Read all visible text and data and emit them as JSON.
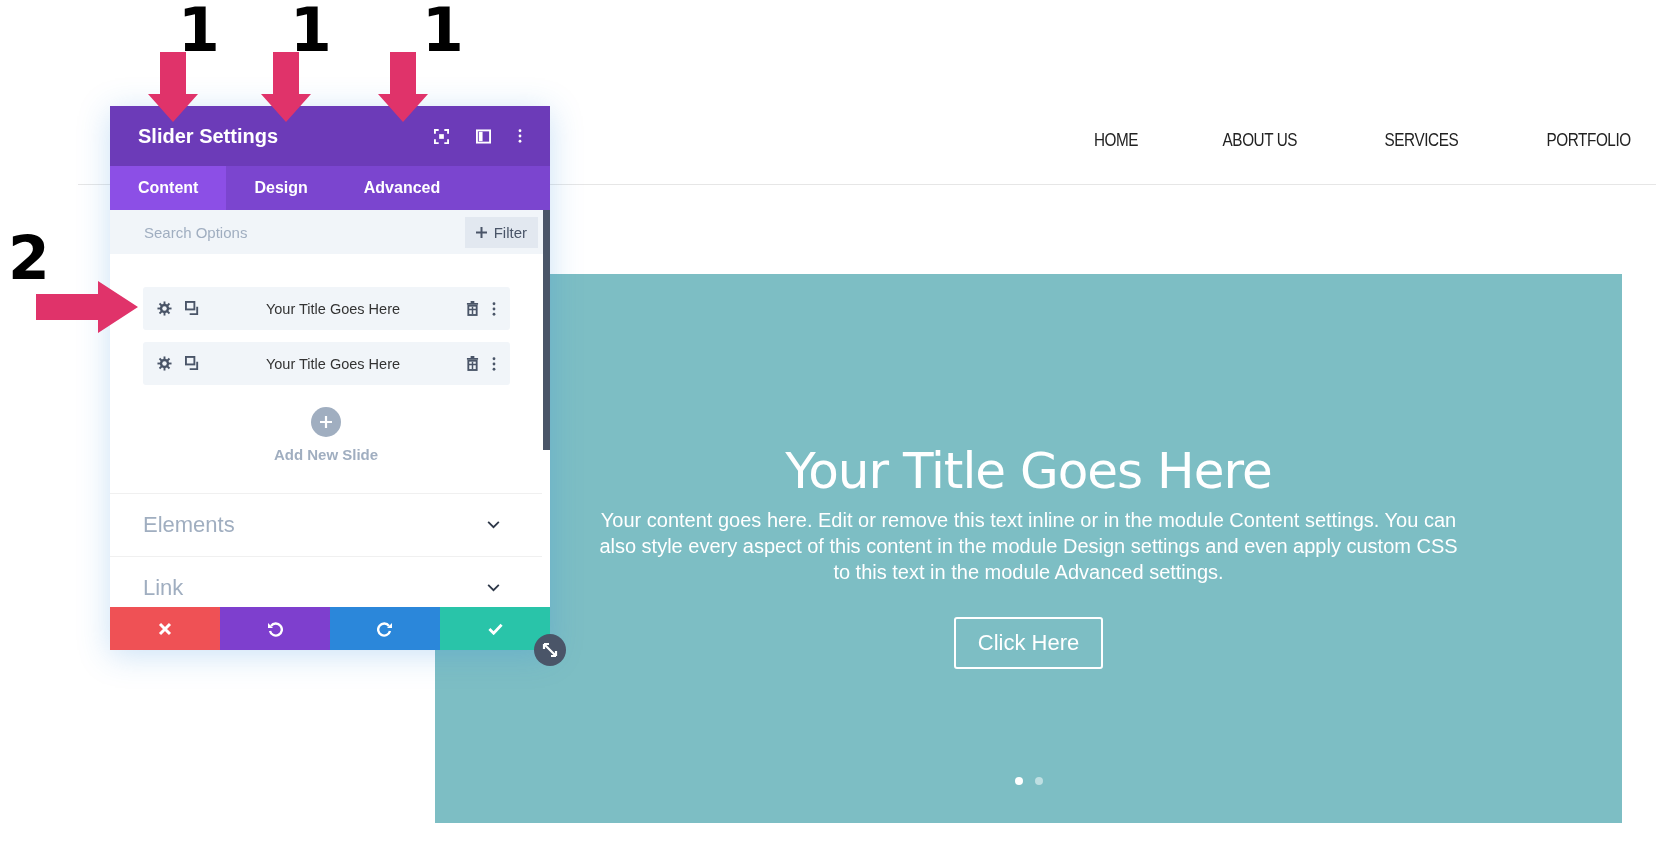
{
  "nav": [
    "HOME",
    "ABOUT US",
    "SERVICES",
    "PORTFOLIO"
  ],
  "slider": {
    "title": "Your Title Goes Here",
    "content": "Your content goes here. Edit or remove this text inline or in the module Content settings. You can also style every aspect of this content in the module Design settings and even apply custom CSS to this text in the module Advanced settings.",
    "button": "Click Here",
    "dots": [
      {
        "selected": true
      },
      {
        "selected": false
      }
    ]
  },
  "panel": {
    "title": "Slider Settings",
    "tabs": [
      {
        "label": "Content",
        "selected": true
      },
      {
        "label": "Design",
        "selected": false
      },
      {
        "label": "Advanced",
        "selected": false
      }
    ],
    "search": {
      "placeholder": "Search Options"
    },
    "filter": "Filter",
    "slides": [
      {
        "title": "Your Title Goes Here"
      },
      {
        "title": "Your Title Goes Here"
      }
    ],
    "add_label": "Add New Slide",
    "sections": [
      {
        "label": "Elements",
        "expanded": false
      },
      {
        "label": "Link",
        "expanded": false
      }
    ],
    "actions": [
      {
        "kind": "cancel"
      },
      {
        "kind": "undo"
      },
      {
        "kind": "redo"
      },
      {
        "kind": "save"
      }
    ]
  },
  "annotations": [
    {
      "kind": "down",
      "label": "1"
    },
    {
      "kind": "down",
      "label": "1"
    },
    {
      "kind": "down",
      "label": "1"
    },
    {
      "kind": "right",
      "label": "2"
    }
  ]
}
